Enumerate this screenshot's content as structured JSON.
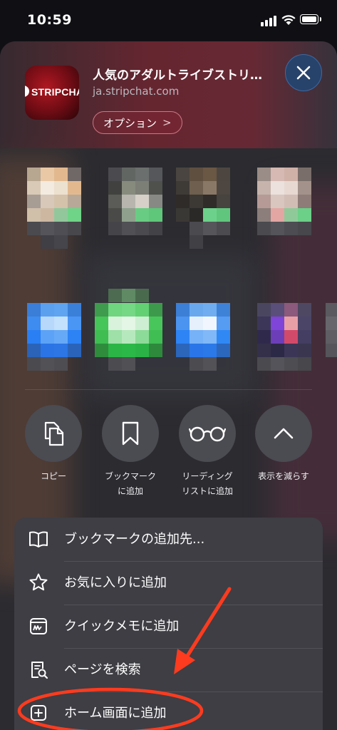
{
  "status_bar": {
    "time": "10:59"
  },
  "share_sheet": {
    "app_icon_text": "STRIPCHAT",
    "title": "人気のアダルトライブストリ…",
    "url": "ja.stripchat.com",
    "options_label": "オプション",
    "options_chevron": ">",
    "close_icon": "close-icon"
  },
  "actions": [
    {
      "label": "コピー",
      "icon": "copy-icon"
    },
    {
      "label": "ブックマーク\nに追加",
      "icon": "bookmark-icon"
    },
    {
      "label": "リーディング\nリストに追加",
      "icon": "reading-glasses-icon"
    },
    {
      "label": "表示を減らす",
      "icon": "chevron-up-icon"
    }
  ],
  "menu": [
    {
      "label": "ブックマークの追加先...",
      "icon": "book-icon"
    },
    {
      "label": "お気に入りに追加",
      "icon": "star-icon"
    },
    {
      "label": "クイックメモに追加",
      "icon": "quick-note-icon"
    },
    {
      "label": "ページを検索",
      "icon": "find-on-page-icon"
    },
    {
      "label": "ホーム画面に追加",
      "icon": "add-square-icon"
    }
  ],
  "annotation": {
    "color": "#ff3b1f"
  }
}
